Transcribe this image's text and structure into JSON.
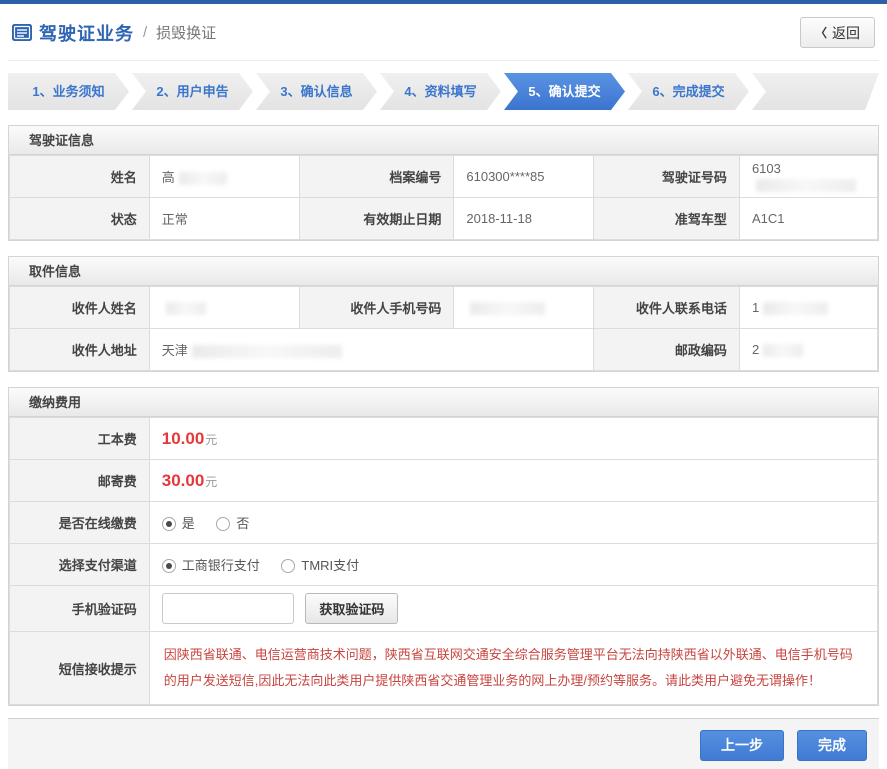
{
  "header": {
    "title": "驾驶证业务",
    "separator": "/",
    "subtitle": "损毁换证",
    "back_chevron": "〈",
    "back_label": "返回"
  },
  "steps": {
    "active_step": 5,
    "s1": "1、业务须知",
    "s2": "2、用户申告",
    "s3": "3、确认信息",
    "s4": "4、资料填写",
    "s5": "5、确认提交",
    "s6": "6、完成提交"
  },
  "license_info": {
    "section_title": "驾驶证信息",
    "name_label": "姓名",
    "name_value": "高",
    "file_no_label": "档案编号",
    "file_no_value": "610300****85",
    "license_no_label": "驾驶证号码",
    "license_no_value": "6103",
    "status_label": "状态",
    "status_value": "正常",
    "expiry_label": "有效期止日期",
    "expiry_value": "2018-11-18",
    "vehicle_class_label": "准驾车型",
    "vehicle_class_value": "A1C1"
  },
  "pickup_info": {
    "section_title": "取件信息",
    "recipient_name_label": "收件人姓名",
    "recipient_name_value": "",
    "recipient_mobile_label": "收件人手机号码",
    "recipient_mobile_value": "",
    "recipient_phone_label": "收件人联系电话",
    "recipient_phone_value": "1",
    "recipient_address_label": "收件人地址",
    "recipient_address_value": "天津",
    "postal_code_label": "邮政编码",
    "postal_code_value": "2"
  },
  "payment": {
    "section_title": "缴纳费用",
    "production_fee_label": "工本费",
    "production_fee_value": "10.00",
    "mailing_fee_label": "邮寄费",
    "mailing_fee_value": "30.00",
    "currency_unit": "元",
    "online_payment_label": "是否在线缴费",
    "online_yes": "是",
    "online_no": "否",
    "online_selected": "是",
    "channel_label": "选择支付渠道",
    "channel_icbc": "工商银行支付",
    "channel_tmri": "TMRI支付",
    "channel_selected": "工商银行支付",
    "sms_code_label": "手机验证码",
    "sms_code_value": "",
    "get_code_button": "获取验证码",
    "sms_notice_label": "短信接收提示",
    "sms_notice_text": "因陕西省联通、电信运营商技术问题，陕西省互联网交通安全综合服务管理平台无法向持陕西省以外联通、电信手机号码的用户发送短信,因此无法向此类用户提供陕西省交通管理业务的网上办理/预约等服务。请此类用户避免无谓操作！"
  },
  "footer": {
    "prev_button": "上一步",
    "finish_button": "完成"
  },
  "colors": {
    "topbar_blue": "#2d5fa6",
    "accent_blue": "#3b76cc",
    "active_step_blue": "#3a74cf",
    "price_red": "#e4393c",
    "notice_red": "#c7453f",
    "button_blue": "#3f7bd3"
  }
}
